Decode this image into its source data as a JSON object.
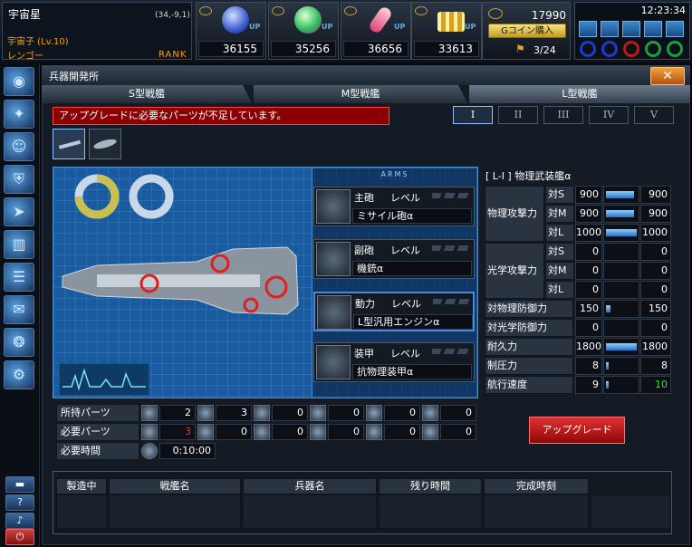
{
  "header": {
    "planet": "宇宙星",
    "coords": "(34,-9,1)",
    "user": "宇宙子 (Lv.10)",
    "job": "レンゴー",
    "rank": "RANK"
  },
  "resources": [
    {
      "value": "36155",
      "up": "UP",
      "color": "#4a7ad8"
    },
    {
      "value": "35256",
      "up": "UP",
      "color": "#30c060"
    },
    {
      "value": "36656",
      "up": "UP",
      "color": "#e04070"
    },
    {
      "value": "33613",
      "up": "UP",
      "color": "#d8b030"
    }
  ],
  "gcoin": {
    "value": "17990",
    "buy_label": "Gコイン購入",
    "count": "3/24"
  },
  "clock": "12:23:34",
  "window": {
    "title": "兵器開発所",
    "close": "✕"
  },
  "tabs": [
    "S型戦艦",
    "M型戦艦",
    "L型戦艦"
  ],
  "warning": "アップグレードに必要なパーツが不足しています。",
  "levels": [
    "I",
    "II",
    "III",
    "IV",
    "V"
  ],
  "arms_header": "ARMS",
  "parts": [
    {
      "name": "主砲",
      "level": "レベル",
      "equip": "ミサイル砲α"
    },
    {
      "name": "副砲",
      "level": "レベル",
      "equip": "機銃α"
    },
    {
      "name": "動力",
      "level": "レベル",
      "equip": "L型汎用エンジンα"
    },
    {
      "name": "装甲",
      "level": "レベル",
      "equip": "抗物理装甲α"
    }
  ],
  "stats": {
    "title": "[ L-I ] 物理武装艦α",
    "phys_label": "物理攻撃力",
    "opt_label": "光学攻撃力",
    "phys": [
      {
        "sub": "対S",
        "v1": "900",
        "v2": "900",
        "fill": 0.9
      },
      {
        "sub": "対M",
        "v1": "900",
        "v2": "900",
        "fill": 0.9
      },
      {
        "sub": "対L",
        "v1": "1000",
        "v2": "1000",
        "fill": 1.0
      }
    ],
    "opt": [
      {
        "sub": "対S",
        "v1": "0",
        "v2": "0",
        "fill": 0
      },
      {
        "sub": "対M",
        "v1": "0",
        "v2": "0",
        "fill": 0
      },
      {
        "sub": "対L",
        "v1": "0",
        "v2": "0",
        "fill": 0
      }
    ],
    "single": [
      {
        "label": "対物理防御力",
        "v1": "150",
        "v2": "150",
        "fill": 0.15,
        "color": ""
      },
      {
        "label": "対光学防御力",
        "v1": "0",
        "v2": "0",
        "fill": 0,
        "color": ""
      },
      {
        "label": "耐久力",
        "v1": "1800",
        "v2": "1800",
        "fill": 1.0,
        "color": ""
      },
      {
        "label": "制圧力",
        "v1": "8",
        "v2": "8",
        "fill": 0.08,
        "color": ""
      },
      {
        "label": "航行速度",
        "v1": "9",
        "v2": "10",
        "fill": 0.09,
        "color": "#40e040"
      }
    ]
  },
  "inventory": {
    "owned_label": "所持パーツ",
    "owned": [
      "2",
      "3",
      "0",
      "0",
      "0",
      "0"
    ],
    "need_label": "必要パーツ",
    "need": [
      "3",
      "0",
      "0",
      "0",
      "0",
      "0"
    ],
    "need_color": "#ff3030",
    "time_label": "必要時間",
    "time": "0:10:00"
  },
  "upgrade_button": "アップグレード",
  "queue_headers": [
    "製造中",
    "戦艦名",
    "兵器名",
    "残り時間",
    "完成時刻"
  ]
}
